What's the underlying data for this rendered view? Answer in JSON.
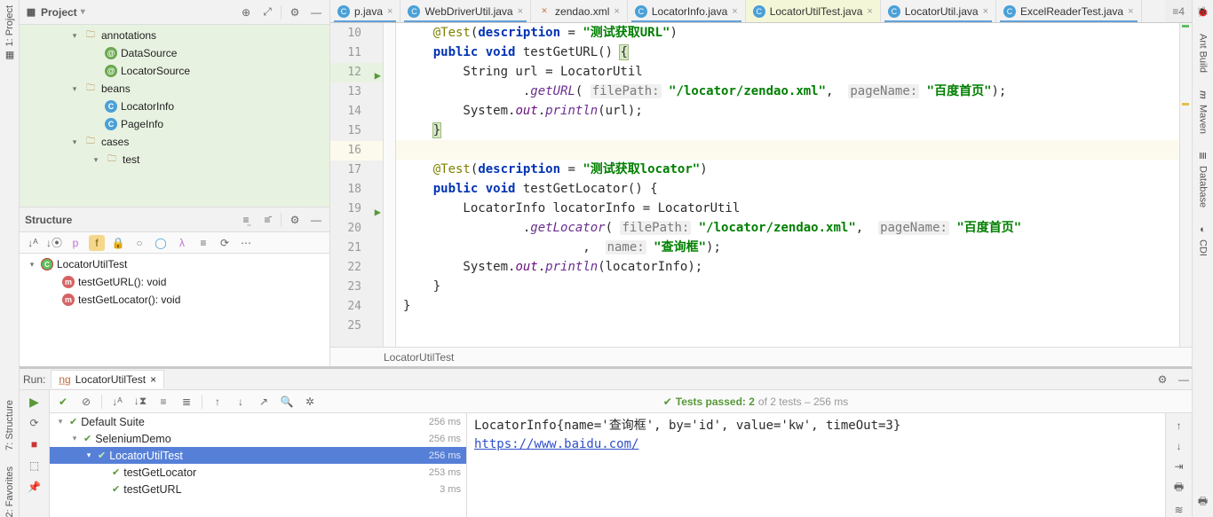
{
  "left_sidebar": {
    "project": "1: Project"
  },
  "left_sidebar_bottom": {
    "structure": "7: Structure",
    "favorites": "2: Favorites"
  },
  "right_sidebar": {
    "ant": "Ant Build",
    "maven": "Maven",
    "database": "Database",
    "cdi": "CDI"
  },
  "project_pane": {
    "title": "Project",
    "tree": [
      {
        "indent": 4,
        "twisty": "▾",
        "icon": "dir",
        "label": "annotations"
      },
      {
        "indent": 6,
        "twisty": "",
        "icon": "ann",
        "label": "DataSource"
      },
      {
        "indent": 6,
        "twisty": "",
        "icon": "ann",
        "label": "LocatorSource"
      },
      {
        "indent": 4,
        "twisty": "▾",
        "icon": "dir",
        "label": "beans"
      },
      {
        "indent": 6,
        "twisty": "",
        "icon": "cls",
        "label": "LocatorInfo"
      },
      {
        "indent": 6,
        "twisty": "",
        "icon": "cls",
        "label": "PageInfo"
      },
      {
        "indent": 4,
        "twisty": "▾",
        "icon": "dir",
        "label": "cases"
      },
      {
        "indent": 6,
        "twisty": "▾",
        "icon": "dir",
        "label": "test"
      }
    ]
  },
  "structure_pane": {
    "title": "Structure",
    "tree": [
      {
        "indent": 0,
        "twisty": "▾",
        "icon": "tcl",
        "label": "LocatorUtilTest"
      },
      {
        "indent": 2,
        "twisty": "",
        "icon": "m",
        "label": "testGetURL(): void"
      },
      {
        "indent": 2,
        "twisty": "",
        "icon": "m",
        "label": "testGetLocator(): void"
      }
    ]
  },
  "tabs": [
    {
      "icon": "java",
      "label": "p.java",
      "active": false,
      "blue": true
    },
    {
      "icon": "java",
      "label": "WebDriverUtil.java",
      "active": false,
      "blue": true
    },
    {
      "icon": "xml",
      "label": "zendao.xml",
      "active": false,
      "blue": false
    },
    {
      "icon": "java",
      "label": "LocatorInfo.java",
      "active": false,
      "blue": true
    },
    {
      "icon": "java",
      "label": "LocatorUtilTest.java",
      "active": true,
      "blue": false
    },
    {
      "icon": "java",
      "label": "LocatorUtil.java",
      "active": false,
      "blue": true
    },
    {
      "icon": "java",
      "label": "ExcelReaderTest.java",
      "active": false,
      "blue": true
    }
  ],
  "tab_counter": "≡4",
  "gutter": {
    "start": 10,
    "end": 25,
    "run_lines": [
      12,
      19
    ],
    "hl": 16,
    "sel": 12
  },
  "code": {
    "l10": "    @Test(description = \"测试获取URL\")",
    "l11": "    public void testGetURL() {",
    "l12": "        String url = LocatorUtil",
    "l13": "                .getURL( filePath: \"/locator/zendao.xml\",  pageName: \"百度首页\");",
    "l14": "        System.out.println(url);",
    "l15": "    }",
    "l16": "",
    "l17": "    @Test(description = \"测试获取locator\")",
    "l18": "    public void testGetLocator() {",
    "l19": "        LocatorInfo locatorInfo = LocatorUtil",
    "l20": "                .getLocator( filePath: \"/locator/zendao.xml\",  pageName: \"百度首页\"",
    "l21": "                        ,  name: \"查询框\");",
    "l22": "        System.out.println(locatorInfo);",
    "l23": "    }",
    "l24": "}"
  },
  "breadcrumb": "LocatorUtilTest",
  "run": {
    "label": "Run:",
    "tab": "LocatorUtilTest",
    "status_prefix": "Tests passed: 2",
    "status_suffix": " of 2 tests – 256 ms",
    "tests": [
      {
        "indent": 0,
        "tw": "▾",
        "name": "Default Suite",
        "time": "256 ms",
        "sel": false
      },
      {
        "indent": 1,
        "tw": "▾",
        "name": "SeleniumDemo",
        "time": "256 ms",
        "sel": false
      },
      {
        "indent": 2,
        "tw": "▾",
        "name": "LocatorUtilTest",
        "time": "256 ms",
        "sel": true
      },
      {
        "indent": 3,
        "tw": "",
        "name": "testGetLocator",
        "time": "253 ms",
        "sel": false
      },
      {
        "indent": 3,
        "tw": "",
        "name": "testGetURL",
        "time": "3 ms",
        "sel": false
      }
    ],
    "console_line1": "LocatorInfo{name='查询框', by='id', value='kw', timeOut=3}",
    "console_link": "https://www.baidu.com/"
  }
}
